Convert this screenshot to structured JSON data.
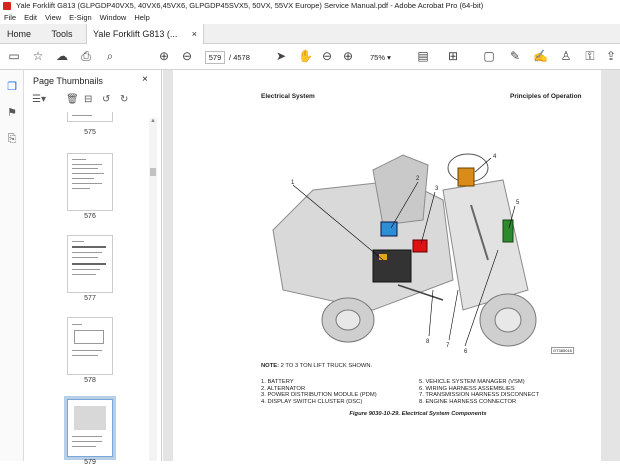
{
  "window": {
    "title": "Yale Forklift G813 (GLPGDP40VX5, 40VX6,45VX6, GLPGDP45SVX5, 50VX, 55VX Europe) Service Manual.pdf - Adobe Acrobat Pro (64-bit)"
  },
  "menu": [
    "File",
    "Edit",
    "View",
    "E-Sign",
    "Window",
    "Help"
  ],
  "tabs": {
    "home": "Home",
    "tools": "Tools",
    "document": "Yale Forklift G813 (...",
    "close": "×"
  },
  "toolbar": {
    "current_page": "579",
    "page_separator": "/",
    "total_pages": "4578",
    "zoom": "75%"
  },
  "thumbnails": {
    "header": "Page Thumbnails",
    "close": "×",
    "pages": [
      {
        "label": "575"
      },
      {
        "label": "576"
      },
      {
        "label": "577"
      },
      {
        "label": "578"
      },
      {
        "label": "579"
      }
    ]
  },
  "document_page": {
    "header_left": "Electrical System",
    "header_right": "Principles of Operation",
    "note_label": "NOTE:",
    "note_text": "2 TO 3 TON LIFT TRUCK SHOWN.",
    "figure_id": "GT385016",
    "legend_left": [
      "1.  BATTERY",
      "2.  ALTERNATOR",
      "3.  POWER DISTRIBUTION MODULE (PDM)",
      "4.  DISPLAY SWITCH CLUSTER (DSC)"
    ],
    "legend_right": [
      "5.  VEHICLE SYSTEM MANAGER (VSM)",
      "6.  WIRING HARNESS ASSEMBLIES",
      "7.  TRANSMISSION HARNESS DISCONNECT",
      "8.  ENGINE HARNESS CONNECTOR"
    ],
    "caption": "Figure 9030-10-29. Electrical System Components",
    "callouts": [
      "1",
      "2",
      "3",
      "4",
      "5",
      "6",
      "7",
      "8"
    ]
  }
}
